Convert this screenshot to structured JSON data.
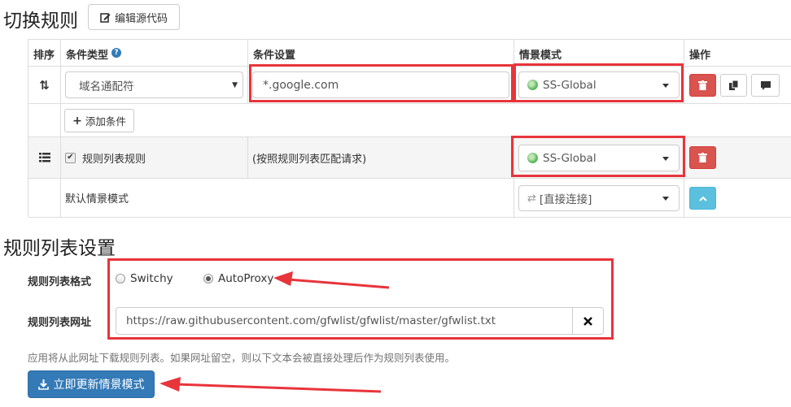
{
  "section1": {
    "title": "切换规则",
    "edit_source_label": "编辑源代码"
  },
  "table": {
    "headers": {
      "sort": "排序",
      "condition_type": "条件类型",
      "condition_setting": "条件设置",
      "profile": "情景模式",
      "actions": "操作"
    },
    "row1": {
      "condition_type": "域名通配符",
      "condition_value": "*.google.com",
      "profile": "SS-Global"
    },
    "add_condition_label": "添加条件",
    "rule_list_row": {
      "label": "规则列表规则",
      "setting_text": "(按照规则列表匹配请求)",
      "profile": "SS-Global",
      "checked": true
    },
    "default_row": {
      "label": "默认情景模式",
      "profile": "[直接连接]"
    }
  },
  "section2": {
    "title": "规则列表设置",
    "format_label": "规则列表格式",
    "format_options": [
      "Switchy",
      "AutoProxy"
    ],
    "format_selected": "AutoProxy",
    "url_label": "规则列表网址",
    "url_value": "https://raw.githubusercontent.com/gfwlist/gfwlist/master/gfwlist.txt",
    "help_text": "应用将从此网址下载规则列表。如果网址留空，则以下文本会被直接处理后作为规则列表使用。",
    "update_button_label": "立即更新情景模式"
  },
  "colors": {
    "highlight": "#e8343b",
    "danger": "#d9534f",
    "primary": "#337ab7",
    "info": "#5bc0de"
  }
}
